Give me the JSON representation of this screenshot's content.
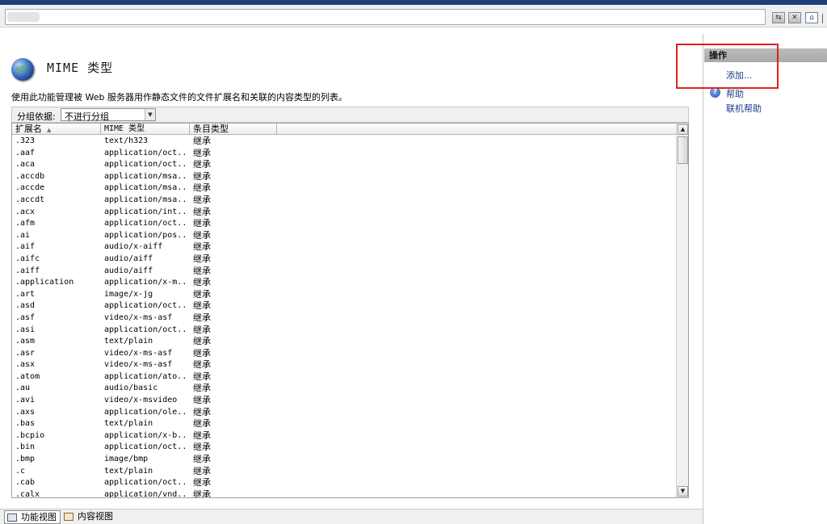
{
  "toolbar": {
    "address_value": "",
    "icons": [
      "refresh-icon",
      "stop-icon",
      "home-icon"
    ]
  },
  "main": {
    "title": "MIME 类型",
    "description": "使用此功能管理被 Web 服务器用作静态文件的文件扩展名和关联的内容类型的列表。",
    "group_label": "分组依据:",
    "group_value": "不进行分组",
    "columns": [
      "扩展名",
      "MIME 类型",
      "条目类型"
    ],
    "rows": [
      {
        "ext": ".323",
        "mime": "text/h323",
        "entry": "继承"
      },
      {
        "ext": ".aaf",
        "mime": "application/oct...",
        "entry": "继承"
      },
      {
        "ext": ".aca",
        "mime": "application/oct...",
        "entry": "继承"
      },
      {
        "ext": ".accdb",
        "mime": "application/msa...",
        "entry": "继承"
      },
      {
        "ext": ".accde",
        "mime": "application/msa...",
        "entry": "继承"
      },
      {
        "ext": ".accdt",
        "mime": "application/msa...",
        "entry": "继承"
      },
      {
        "ext": ".acx",
        "mime": "application/int...",
        "entry": "继承"
      },
      {
        "ext": ".afm",
        "mime": "application/oct...",
        "entry": "继承"
      },
      {
        "ext": ".ai",
        "mime": "application/pos...",
        "entry": "继承"
      },
      {
        "ext": ".aif",
        "mime": "audio/x-aiff",
        "entry": "继承"
      },
      {
        "ext": ".aifc",
        "mime": "audio/aiff",
        "entry": "继承"
      },
      {
        "ext": ".aiff",
        "mime": "audio/aiff",
        "entry": "继承"
      },
      {
        "ext": ".application",
        "mime": "application/x-m...",
        "entry": "继承"
      },
      {
        "ext": ".art",
        "mime": "image/x-jg",
        "entry": "继承"
      },
      {
        "ext": ".asd",
        "mime": "application/oct...",
        "entry": "继承"
      },
      {
        "ext": ".asf",
        "mime": "video/x-ms-asf",
        "entry": "继承"
      },
      {
        "ext": ".asi",
        "mime": "application/oct...",
        "entry": "继承"
      },
      {
        "ext": ".asm",
        "mime": "text/plain",
        "entry": "继承"
      },
      {
        "ext": ".asr",
        "mime": "video/x-ms-asf",
        "entry": "继承"
      },
      {
        "ext": ".asx",
        "mime": "video/x-ms-asf",
        "entry": "继承"
      },
      {
        "ext": ".atom",
        "mime": "application/ato...",
        "entry": "继承"
      },
      {
        "ext": ".au",
        "mime": "audio/basic",
        "entry": "继承"
      },
      {
        "ext": ".avi",
        "mime": "video/x-msvideo",
        "entry": "继承"
      },
      {
        "ext": ".axs",
        "mime": "application/ole...",
        "entry": "继承"
      },
      {
        "ext": ".bas",
        "mime": "text/plain",
        "entry": "继承"
      },
      {
        "ext": ".bcpio",
        "mime": "application/x-b...",
        "entry": "继承"
      },
      {
        "ext": ".bin",
        "mime": "application/oct...",
        "entry": "继承"
      },
      {
        "ext": ".bmp",
        "mime": "image/bmp",
        "entry": "继承"
      },
      {
        "ext": ".c",
        "mime": "text/plain",
        "entry": "继承"
      },
      {
        "ext": ".cab",
        "mime": "application/oct...",
        "entry": "继承"
      },
      {
        "ext": ".calx",
        "mime": "application/vnd...",
        "entry": "继承"
      }
    ]
  },
  "view_tabs": {
    "features": "功能视图",
    "content": "内容视图"
  },
  "actions": {
    "header": "操作",
    "add": "添加...",
    "help": "帮助",
    "online_help": "联机帮助"
  },
  "colors": {
    "accent_blue": "#1a3c8c",
    "highlight_red": "#e0201e",
    "title_bar": "#1f3f7a"
  }
}
